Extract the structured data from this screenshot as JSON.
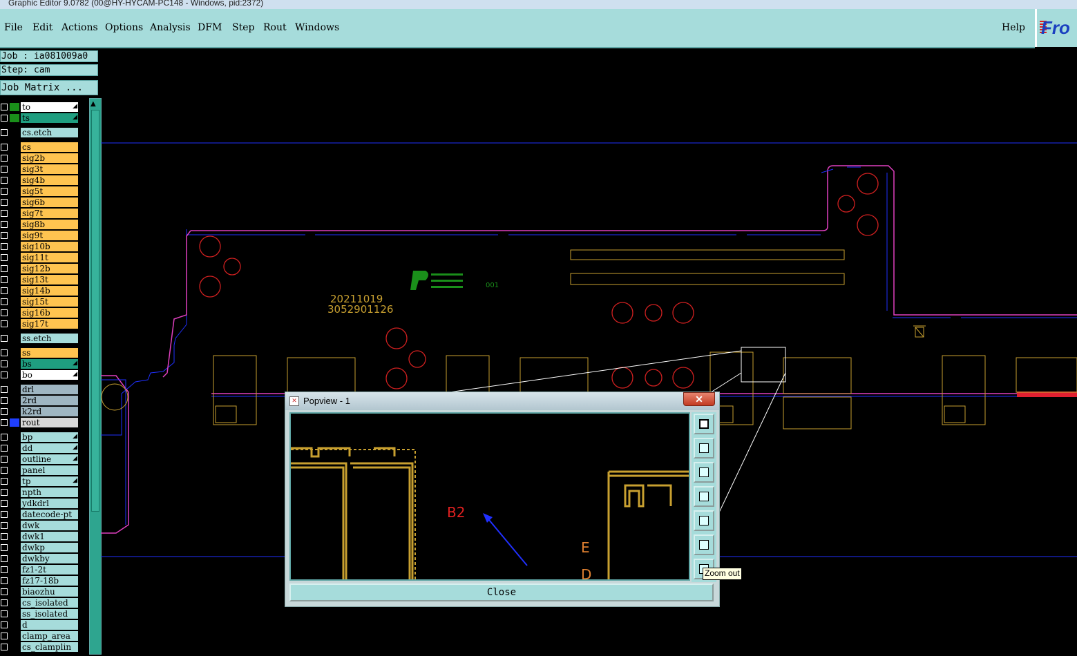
{
  "window": {
    "title": "Graphic Editor 9.0782 (00@HY-HYCAM-PC148 - Windows, pid:2372)"
  },
  "menu": {
    "file": "File",
    "edit": "Edit",
    "actions": "Actions",
    "options": "Options",
    "analysis": "Analysis",
    "dfm": "DFM",
    "step": "Step",
    "rout": "Rout",
    "windows": "Windows",
    "help": "Help"
  },
  "brand": {
    "text": "Fro",
    "accent": "#1a3fc0"
  },
  "job": {
    "label": "Job : ia081009a0",
    "step": "Step: cam",
    "matrix_button": "Job Matrix ..."
  },
  "layers": [
    {
      "name": "to",
      "bg": "#ffffff",
      "swatch": "#1a8f1a",
      "flag": true
    },
    {
      "name": "ts",
      "bg": "#1f9e80",
      "swatch": "#1a8f1a",
      "flag": true
    },
    {
      "name": "cs.etch",
      "bg": "#a6dcdb",
      "swatch": "",
      "flag": false,
      "gap": true
    },
    {
      "name": "cs",
      "bg": "#ffc450",
      "swatch": "",
      "flag": false,
      "gap": true
    },
    {
      "name": "sig2b",
      "bg": "#ffc450",
      "swatch": "",
      "flag": false
    },
    {
      "name": "sig3t",
      "bg": "#ffc450",
      "swatch": "",
      "flag": false
    },
    {
      "name": "sig4b",
      "bg": "#ffc450",
      "swatch": "",
      "flag": false
    },
    {
      "name": "sig5t",
      "bg": "#ffc450",
      "swatch": "",
      "flag": false
    },
    {
      "name": "sig6b",
      "bg": "#ffc450",
      "swatch": "",
      "flag": false
    },
    {
      "name": "sig7t",
      "bg": "#ffc450",
      "swatch": "",
      "flag": false
    },
    {
      "name": "sig8b",
      "bg": "#ffc450",
      "swatch": "",
      "flag": false
    },
    {
      "name": "sig9t",
      "bg": "#ffc450",
      "swatch": "",
      "flag": false
    },
    {
      "name": "sig10b",
      "bg": "#ffc450",
      "swatch": "",
      "flag": false
    },
    {
      "name": "sig11t",
      "bg": "#ffc450",
      "swatch": "",
      "flag": false
    },
    {
      "name": "sig12b",
      "bg": "#ffc450",
      "swatch": "",
      "flag": false
    },
    {
      "name": "sig13t",
      "bg": "#ffc450",
      "swatch": "",
      "flag": false
    },
    {
      "name": "sig14b",
      "bg": "#ffc450",
      "swatch": "",
      "flag": false
    },
    {
      "name": "sig15t",
      "bg": "#ffc450",
      "swatch": "",
      "flag": false
    },
    {
      "name": "sig16b",
      "bg": "#ffc450",
      "swatch": "",
      "flag": false
    },
    {
      "name": "sig17t",
      "bg": "#ffc450",
      "swatch": "",
      "flag": false
    },
    {
      "name": "ss.etch",
      "bg": "#a6dcdb",
      "swatch": "",
      "flag": false,
      "gap": true
    },
    {
      "name": "ss",
      "bg": "#ffc450",
      "swatch": "",
      "flag": false,
      "gap": true
    },
    {
      "name": "bs",
      "bg": "#1f9e80",
      "swatch": "",
      "flag": true
    },
    {
      "name": "bo",
      "bg": "#ffffff",
      "swatch": "",
      "flag": true
    },
    {
      "name": "drl",
      "bg": "#9fb6c2",
      "swatch": "",
      "flag": false,
      "gap": true
    },
    {
      "name": "2rd",
      "bg": "#9fb6c2",
      "swatch": "",
      "flag": false
    },
    {
      "name": "k2rd",
      "bg": "#9fb6c2",
      "swatch": "",
      "flag": false
    },
    {
      "name": "rout",
      "bg": "#d8d8d8",
      "swatch": "#1f3fff",
      "flag": false
    },
    {
      "name": "bp",
      "bg": "#a6dcdb",
      "swatch": "",
      "flag": true,
      "gap": true
    },
    {
      "name": "dd",
      "bg": "#a6dcdb",
      "swatch": "",
      "flag": true
    },
    {
      "name": "outline",
      "bg": "#a6dcdb",
      "swatch": "",
      "flag": true
    },
    {
      "name": "panel",
      "bg": "#a6dcdb",
      "swatch": "",
      "flag": false
    },
    {
      "name": "tp",
      "bg": "#a6dcdb",
      "swatch": "",
      "flag": true
    },
    {
      "name": "npth",
      "bg": "#a6dcdb",
      "swatch": "",
      "flag": false
    },
    {
      "name": "ydkdrl",
      "bg": "#a6dcdb",
      "swatch": "",
      "flag": false
    },
    {
      "name": "datecode-pt",
      "bg": "#a6dcdb",
      "swatch": "",
      "flag": false
    },
    {
      "name": "dwk",
      "bg": "#a6dcdb",
      "swatch": "",
      "flag": false
    },
    {
      "name": "dwk1",
      "bg": "#a6dcdb",
      "swatch": "",
      "flag": false
    },
    {
      "name": "dwkp",
      "bg": "#a6dcdb",
      "swatch": "",
      "flag": false
    },
    {
      "name": "dwkby",
      "bg": "#a6dcdb",
      "swatch": "",
      "flag": false
    },
    {
      "name": "fz1-2t",
      "bg": "#a6dcdb",
      "swatch": "",
      "flag": false
    },
    {
      "name": "fz17-18b",
      "bg": "#a6dcdb",
      "swatch": "",
      "flag": false
    },
    {
      "name": "biaozhu",
      "bg": "#a6dcdb",
      "swatch": "",
      "flag": false
    },
    {
      "name": "cs_isolated",
      "bg": "#a6dcdb",
      "swatch": "",
      "flag": false
    },
    {
      "name": "ss_isolated",
      "bg": "#a6dcdb",
      "swatch": "",
      "flag": false
    },
    {
      "name": "d",
      "bg": "#a6dcdb",
      "swatch": "",
      "flag": false
    },
    {
      "name": "clamp_area",
      "bg": "#a6dcdb",
      "swatch": "",
      "flag": false
    },
    {
      "name": "cs_clamplin",
      "bg": "#a6dcdb",
      "swatch": "",
      "flag": false
    }
  ],
  "board": {
    "date_code": "20211019",
    "serial": "3052901126",
    "marker": "001"
  },
  "popview": {
    "title": "Popview - 1",
    "close_x": "✕",
    "label_b2": "B2",
    "label_e": "E",
    "label_d": "D",
    "close_button": "Close",
    "tooltip": "Zoom out",
    "tools": [
      "zoom-home-icon",
      "pan-up-icon",
      "pan-down-icon",
      "pan-left-icon",
      "pan-right-icon",
      "zoom-in-icon",
      "zoom-out-icon"
    ]
  },
  "colors": {
    "panel_teal": "#a6dcdb",
    "copper": "#c8a030",
    "outline_magenta": "#e040c0",
    "rout_blue": "#2030ff",
    "drill_red": "#d02020"
  }
}
